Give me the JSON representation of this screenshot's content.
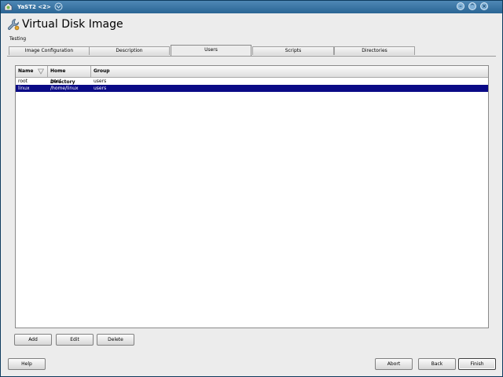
{
  "window": {
    "title": "YaST2 <2>",
    "buttons": [
      "minimize-icon",
      "maximize-icon",
      "close-icon"
    ]
  },
  "header": {
    "title": "Virtual Disk Image",
    "icon": "wrench-icon",
    "subtitle": "Testing"
  },
  "tabs": [
    {
      "label": "Image Configuration",
      "active": false
    },
    {
      "label": "Description",
      "active": false
    },
    {
      "label": "Users",
      "active": true
    },
    {
      "label": "Scripts",
      "active": false
    },
    {
      "label": "Directories",
      "active": false
    }
  ],
  "table": {
    "columns": [
      "Name",
      "Home Directory",
      "Group"
    ],
    "sort_column": "Name",
    "rows": [
      {
        "name": "root",
        "home": "/root",
        "group": "users",
        "selected": false
      },
      {
        "name": "linux",
        "home": "/home/linux",
        "group": "users",
        "selected": true
      }
    ]
  },
  "actions": {
    "add": "Add",
    "edit": "Edit",
    "delete": "Delete"
  },
  "footer": {
    "help": "Help",
    "abort": "Abort",
    "back": "Back",
    "finish": "Finish"
  },
  "colors": {
    "titlebar": "#2a6594",
    "selection": "#0a0a86",
    "background": "#ececec"
  }
}
